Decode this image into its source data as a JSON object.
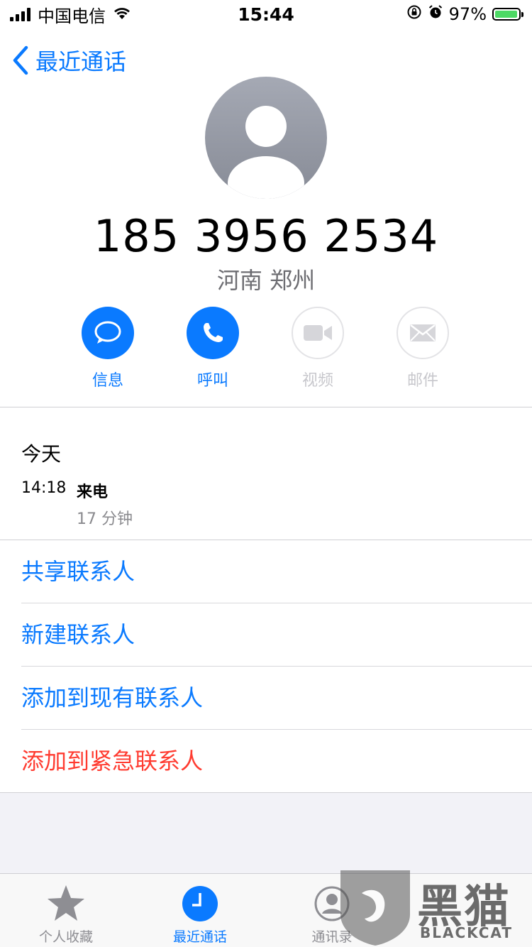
{
  "status_bar": {
    "carrier": "中国电信",
    "time": "15:44",
    "battery_percent": "97%"
  },
  "nav": {
    "back_label": "最近通话"
  },
  "contact": {
    "phone_number": "185 3956 2534",
    "location": "河南 郑州"
  },
  "actions": [
    {
      "label": "信息",
      "icon": "message-icon",
      "enabled": true
    },
    {
      "label": "呼叫",
      "icon": "phone-icon",
      "enabled": true
    },
    {
      "label": "视频",
      "icon": "video-icon",
      "enabled": false
    },
    {
      "label": "邮件",
      "icon": "mail-icon",
      "enabled": false
    }
  ],
  "history": {
    "day": "今天",
    "time": "14:18",
    "type": "来电",
    "duration": "17 分钟"
  },
  "menu": {
    "share_contact": "共享联系人",
    "new_contact": "新建联系人",
    "add_existing": "添加到现有联系人",
    "add_emergency": "添加到紧急联系人"
  },
  "tabbar": [
    {
      "label": "个人收藏",
      "icon": "star-icon",
      "active": false
    },
    {
      "label": "最近通话",
      "icon": "clock-icon",
      "active": true
    },
    {
      "label": "通讯录",
      "icon": "contacts-icon",
      "active": false
    }
  ],
  "watermark": {
    "text": "黑猫",
    "subtext": "BLACKCAT"
  },
  "colors": {
    "accent": "#0a7aff",
    "danger": "#ff3b30",
    "secondary_text": "#8e8e93"
  }
}
